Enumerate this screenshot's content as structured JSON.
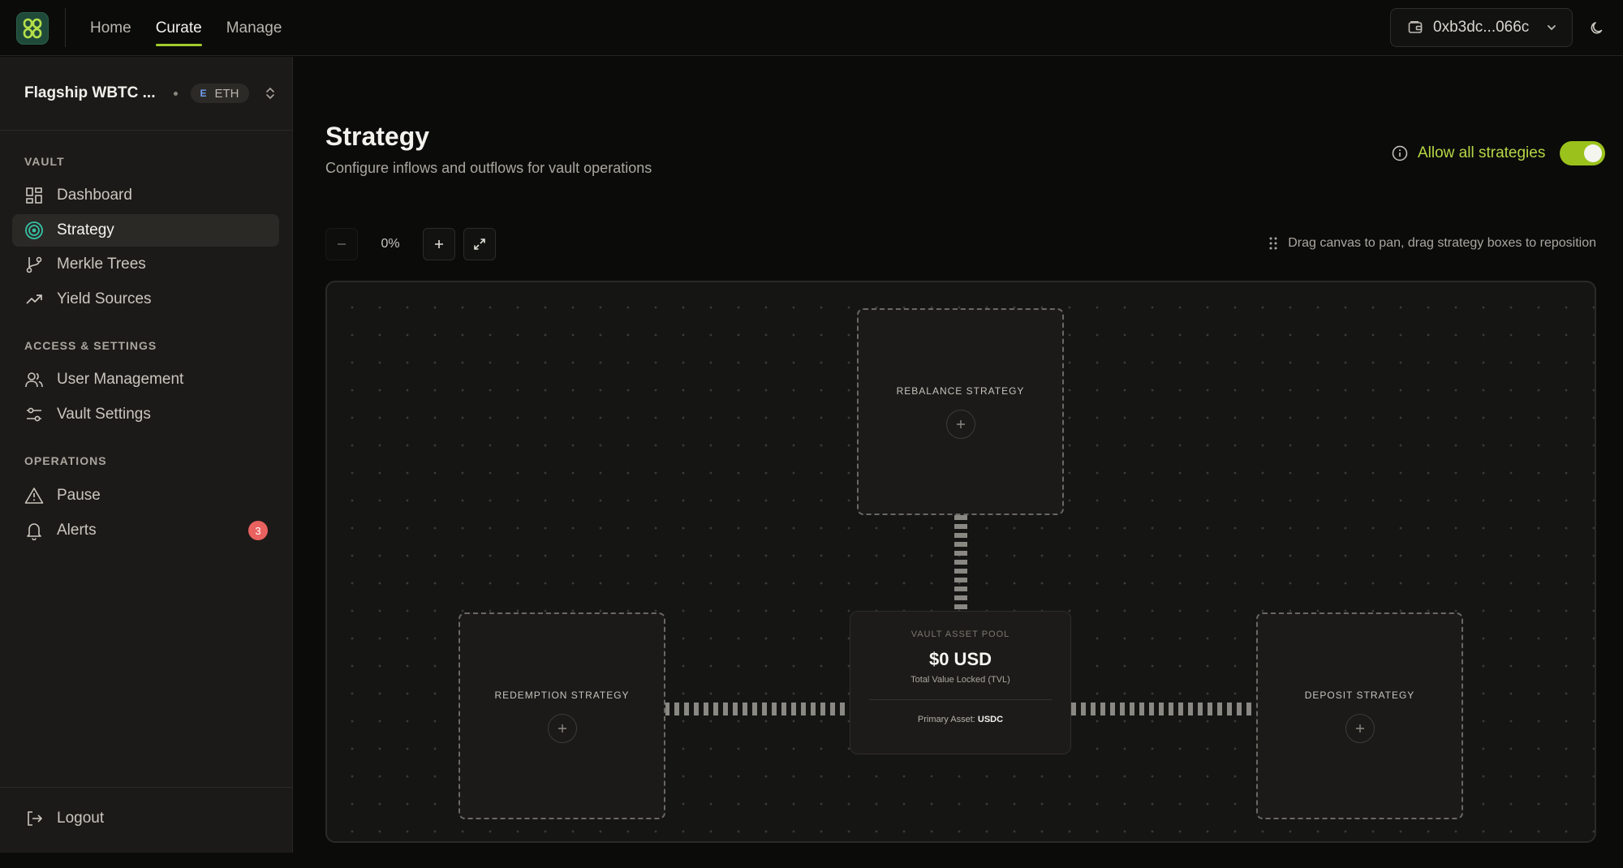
{
  "topbar": {
    "nav": [
      {
        "label": "Home",
        "active": false
      },
      {
        "label": "Curate",
        "active": true
      },
      {
        "label": "Manage",
        "active": false
      }
    ],
    "wallet_address": "0xb3dc...066c",
    "accent": "#a3cc2a"
  },
  "sidebar": {
    "vault_name": "Flagship WBTC ...",
    "chain_letter": "E",
    "chain": "ETH",
    "sections": {
      "vault": "VAULT",
      "access": "ACCESS & SETTINGS",
      "operations": "OPERATIONS"
    },
    "items": {
      "dashboard": "Dashboard",
      "strategy": "Strategy",
      "merkle": "Merkle Trees",
      "yield": "Yield Sources",
      "users": "User Management",
      "settings": "Vault Settings",
      "pause": "Pause",
      "alerts": "Alerts"
    },
    "alerts_count": "3",
    "logout": "Logout"
  },
  "main": {
    "title": "Strategy",
    "subtitle": "Configure inflows and outflows for vault operations",
    "allow_all_label": "Allow all strategies",
    "allow_all_enabled": true,
    "zoom": "0%",
    "hint": "Drag canvas to pan, drag strategy boxes to reposition"
  },
  "canvas": {
    "rebalance": "REBALANCE STRATEGY",
    "redemption": "REDEMPTION STRATEGY",
    "deposit": "DEPOSIT STRATEGY",
    "pool": {
      "label": "VAULT ASSET POOL",
      "value": "$0 USD",
      "tvl_label": "Total Value Locked (TVL)",
      "primary_label": "Primary Asset:",
      "primary_asset": "USDC"
    }
  }
}
